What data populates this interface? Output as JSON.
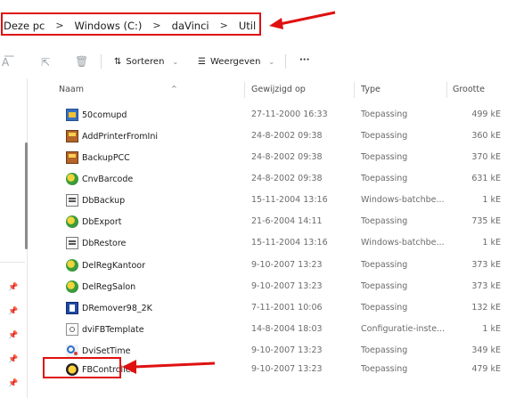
{
  "breadcrumb": {
    "items": [
      "Deze pc",
      "Windows (C:)",
      "daVinci",
      "Util"
    ],
    "separator": ">"
  },
  "toolbar": {
    "sort_label": "Sorteren",
    "view_label": "Weergeven",
    "more_label": "···"
  },
  "columns": {
    "name": "Naam",
    "modified": "Gewijzigd op",
    "type": "Type",
    "size": "Grootte"
  },
  "files": [
    {
      "name": "50comupd",
      "modified": "27-11-2000 16:33",
      "type": "Toepassing",
      "size": "499 kE",
      "icon": "app-icon"
    },
    {
      "name": "AddPrinterFromIni",
      "modified": "24-8-2002 09:38",
      "type": "Toepassing",
      "size": "360 kE",
      "icon": "printer-app-icon"
    },
    {
      "name": "BackupPCC",
      "modified": "24-8-2002 09:38",
      "type": "Toepassing",
      "size": "370 kE",
      "icon": "printer-app-icon"
    },
    {
      "name": "CnvBarcode",
      "modified": "24-8-2002 09:38",
      "type": "Toepassing",
      "size": "631 kE",
      "icon": "globe-app-icon"
    },
    {
      "name": "DbBackup",
      "modified": "15-11-2004 13:16",
      "type": "Windows-batchbe...",
      "size": "1 kE",
      "icon": "batch-file-icon"
    },
    {
      "name": "DbExport",
      "modified": "21-6-2004 14:11",
      "type": "Toepassing",
      "size": "735 kE",
      "icon": "globe-app-icon"
    },
    {
      "name": "DbRestore",
      "modified": "15-11-2004 13:16",
      "type": "Windows-batchbe...",
      "size": "1 kE",
      "icon": "batch-file-icon"
    },
    {
      "name": "DelRegKantoor",
      "modified": "9-10-2007 13:23",
      "type": "Toepassing",
      "size": "373 kE",
      "icon": "globe-app-icon"
    },
    {
      "name": "DelRegSalon",
      "modified": "9-10-2007 13:23",
      "type": "Toepassing",
      "size": "373 kE",
      "icon": "globe-app-icon"
    },
    {
      "name": "DRemover98_2K",
      "modified": "7-11-2001 10:06",
      "type": "Toepassing",
      "size": "132 kE",
      "icon": "dremover-app-icon"
    },
    {
      "name": "dviFBTemplate",
      "modified": "14-8-2004 18:03",
      "type": "Configuratie-inste...",
      "size": "1 kE",
      "icon": "config-file-icon"
    },
    {
      "name": "DviSetTime",
      "modified": "9-10-2007 13:23",
      "type": "Toepassing",
      "size": "349 kE",
      "icon": "search-app-icon"
    },
    {
      "name": "FBController",
      "modified": "9-10-2007 13:23",
      "type": "Toepassing",
      "size": "479 kE",
      "icon": "fb-app-icon"
    }
  ],
  "colors": {
    "highlight": "#e01010",
    "background": "#ffffff"
  }
}
